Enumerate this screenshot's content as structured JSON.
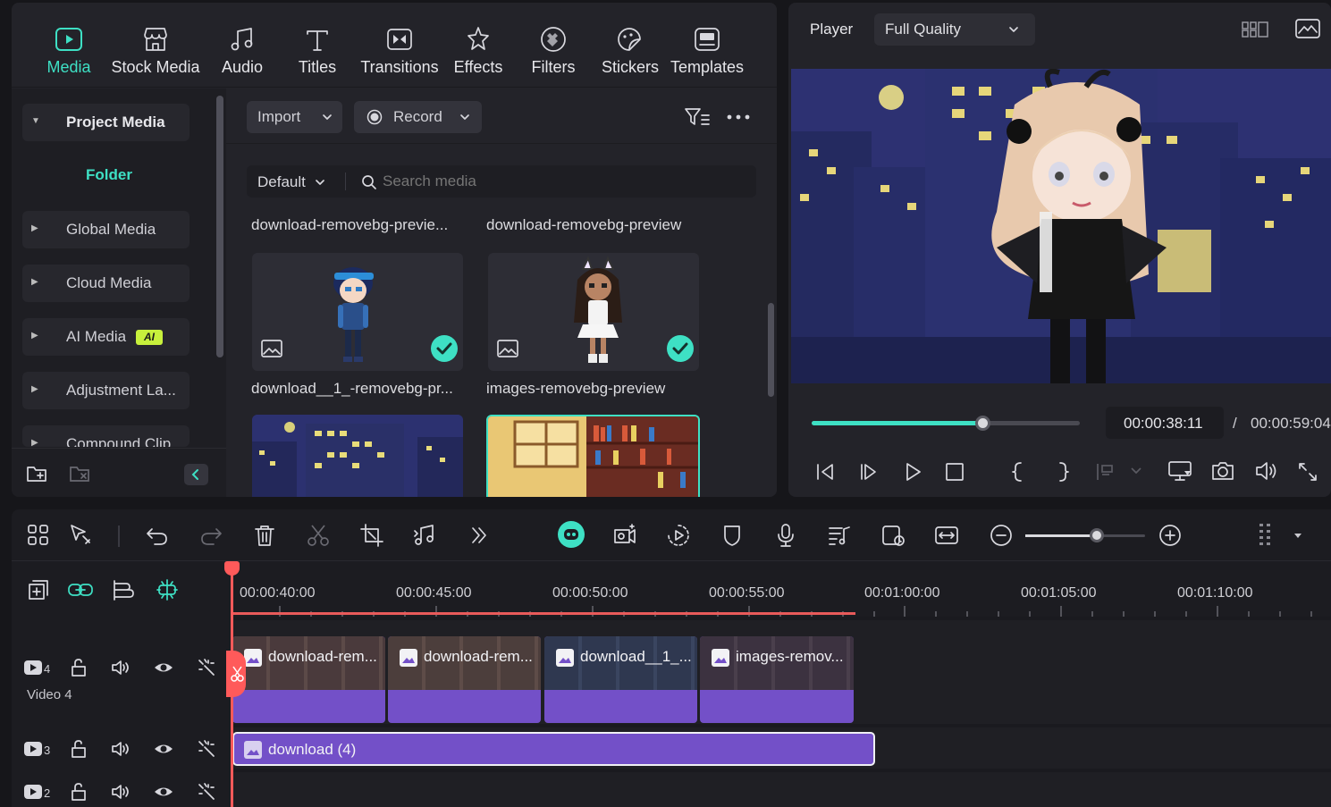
{
  "media": {
    "tabs": [
      {
        "label": "Media",
        "icon": "media-icon"
      },
      {
        "label": "Stock Media",
        "icon": "stock-media-icon"
      },
      {
        "label": "Audio",
        "icon": "audio-icon"
      },
      {
        "label": "Titles",
        "icon": "titles-icon"
      },
      {
        "label": "Transitions",
        "icon": "transitions-icon"
      },
      {
        "label": "Effects",
        "icon": "effects-icon"
      },
      {
        "label": "Filters",
        "icon": "filters-icon"
      },
      {
        "label": "Stickers",
        "icon": "stickers-icon"
      },
      {
        "label": "Templates",
        "icon": "templates-icon"
      }
    ],
    "sidebar": {
      "items": [
        {
          "label": "Project Media"
        },
        {
          "label": "Folder"
        },
        {
          "label": "Global Media"
        },
        {
          "label": "Cloud Media"
        },
        {
          "label": "AI Media",
          "badge": "AI"
        },
        {
          "label": "Adjustment La..."
        },
        {
          "label": "Compound Clip"
        }
      ]
    },
    "toolbar": {
      "import_label": "Import",
      "record_label": "Record"
    },
    "filter": {
      "sort_label": "Default",
      "search_placeholder": "Search media"
    },
    "items": [
      {
        "name": "download-removebg-previe..."
      },
      {
        "name": "download-removebg-preview"
      },
      {
        "name": "download__1_-removebg-pr...",
        "checked": true
      },
      {
        "name": "images-removebg-preview",
        "checked": true
      }
    ],
    "accent_color": "#3ee0c4"
  },
  "player": {
    "label": "Player",
    "quality": "Full Quality",
    "current_time": "00:00:38:11",
    "separator": "/",
    "total_time": "00:00:59:04",
    "progress": 0.64
  },
  "timeline": {
    "ruler": [
      "00:00:40:00",
      "00:00:45:00",
      "00:00:50:00",
      "00:00:55:00",
      "00:01:00:00",
      "00:01:05:00",
      "00:01:10:00"
    ],
    "tracks": [
      {
        "number": "4",
        "name": "Video 4"
      },
      {
        "number": "3"
      },
      {
        "number": "2"
      }
    ],
    "clips_track4": [
      {
        "name": "download-rem..."
      },
      {
        "name": "download-rem..."
      },
      {
        "name": "download__1_..."
      },
      {
        "name": "images-remov..."
      }
    ],
    "clip_track3": {
      "name": "download (4)"
    },
    "zoom_level": 0.6,
    "clip_color": "#7350c8"
  }
}
